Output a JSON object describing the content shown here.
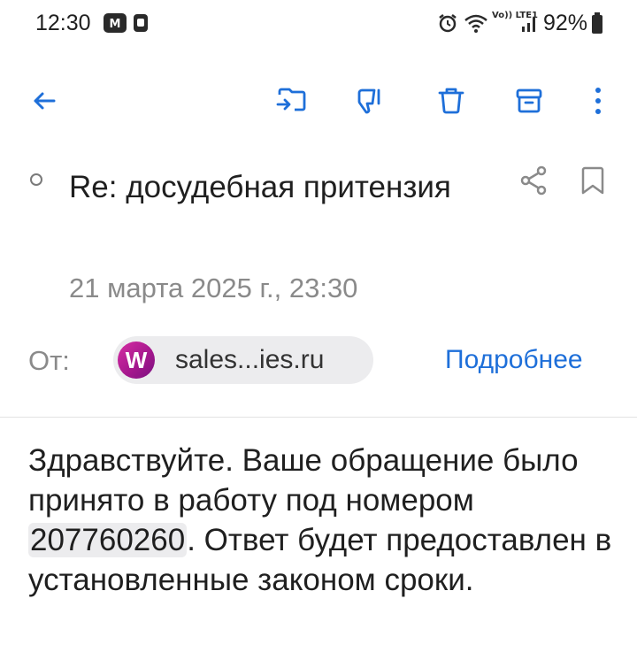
{
  "status_bar": {
    "time": "12:30",
    "battery": "92%",
    "icons": [
      "notification-m-icon",
      "notification-square-icon",
      "alarm-icon",
      "wifi-icon",
      "volte-icon",
      "signal-icon",
      "battery-icon"
    ],
    "volte_text": "Vo)) LTE1"
  },
  "toolbar": {
    "icons": [
      "back-arrow-icon",
      "move-folder-icon",
      "thumbs-down-icon",
      "trash-icon",
      "archive-icon",
      "more-vert-icon"
    ],
    "accent_color": "#1e6fd9"
  },
  "email": {
    "subject": "Re: досудебная притензия",
    "date": "21 марта 2025 г., 23:30",
    "from_label": "От:",
    "sender_initial": "W",
    "sender": "sales...ies.ru",
    "details_link": "Подробнее",
    "body_before": "Здравствуйте. Ваше обращение было принято в работу под номером ",
    "ticket_number": "207760260",
    "body_after": ". Ответ будет предоставлен в установленные законом сроки."
  }
}
